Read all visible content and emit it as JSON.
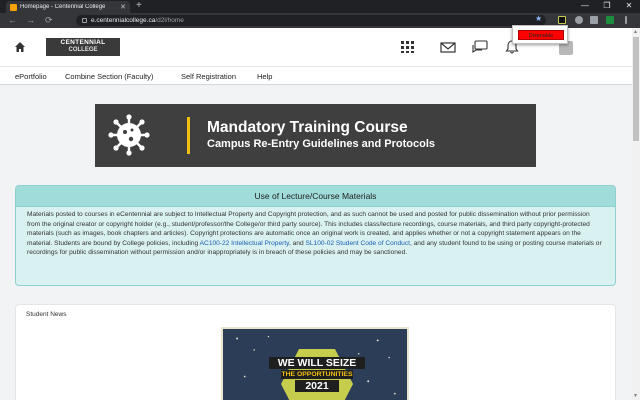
{
  "browser": {
    "tab_title": "Homepage - Centennial College",
    "new_tab_symbol": "+",
    "close_symbol": "✕",
    "url_host": "e.centennialcollege.ca",
    "url_path": "/d2l/home",
    "window_controls": [
      "—",
      "❐",
      "✕"
    ],
    "nav_back": "←",
    "nav_forward": "→",
    "nav_reload": "⟳",
    "star_symbol": "★"
  },
  "popup": {
    "button_label": "Disenable"
  },
  "header": {
    "logo_line1": "CENTENNIAL",
    "logo_line2": "COLLEGE"
  },
  "nav": {
    "items": [
      "ePortfolio",
      "Combine Section (Faculty)",
      "Self Registration",
      "Help"
    ]
  },
  "banner": {
    "title": "Mandatory Training Course",
    "subtitle": "Campus Re-Entry Guidelines and Protocols"
  },
  "notice": {
    "heading": "Use of Lecture/Course Materials",
    "body_part1": "Materials posted to courses in eCentennial are subject to Intellectual Property and Copyright protection, and as such cannot be used and posted for public dissemination without prior permission from the original creator or copyright holder (e.g., student/professor/the College/or third party source). This includes class/lecture recordings, course materials, and third party copyright-protected materials (such as images, book chapters and articles). Copyright protections are automatic once an original work is created, and applies whether or not a copyright statement appears on the material. Students are bound by College policies, including ",
    "link1": "AC100-22 Intellectual Property",
    "body_part2": ", and ",
    "link2": "SL100-02 Student Code of Conduct",
    "body_part3": ", and any student found to be using or posting course materials or recordings for public dissemination without permission and/or inappropriately is in breach of these policies and may be sanctioned."
  },
  "news": {
    "title": "Student News",
    "poster_line1": "WE WILL SEIZE",
    "poster_line2": "THE OPPORTUNITIES",
    "poster_line3": "2021"
  },
  "colors": {
    "brand_dark": "#3a3a3a",
    "banner_bg": "#3f3f3f",
    "banner_accent": "#f2c00f",
    "notice_bg": "#d9f1f0",
    "notice_header": "#9fdcda",
    "link": "#1a5fb4",
    "popup_button": "#ff0000"
  },
  "icons": [
    "home-icon",
    "apps-grid-icon",
    "mail-icon",
    "chat-icon",
    "bell-icon",
    "virus-icon",
    "lock-icon",
    "star-icon"
  ]
}
